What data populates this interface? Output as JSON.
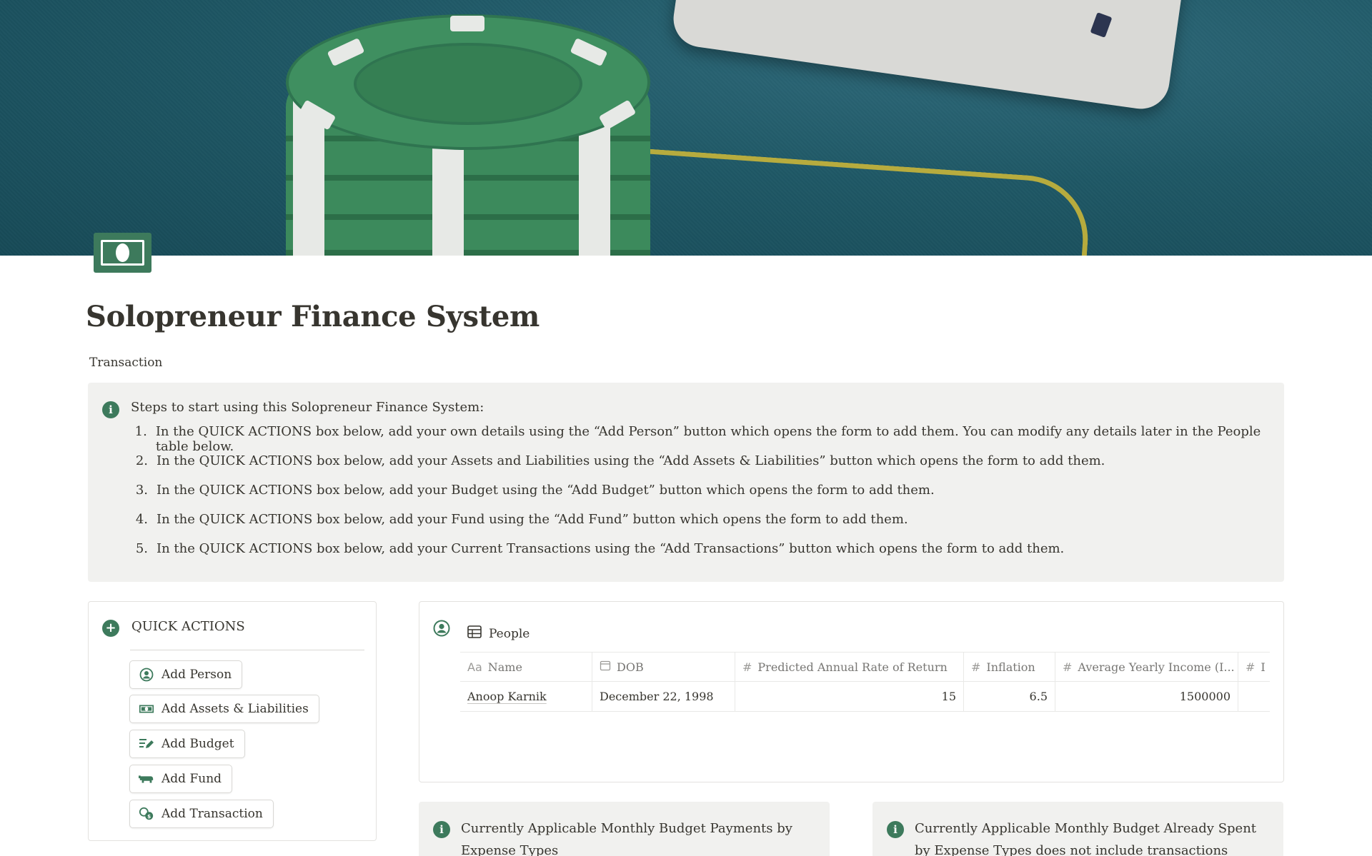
{
  "page": {
    "title": "Solopreneur Finance System",
    "subtitle": "Transaction",
    "icon": "dollar-bill-icon"
  },
  "callout": {
    "icon": "info-icon",
    "lead": "Steps to start using this Solopreneur Finance System:",
    "steps": [
      {
        "num": "1.",
        "text": "In the QUICK ACTIONS box below, add your own details using the “Add Person” button which opens the form to add them. You can modify any details later in the People table below."
      },
      {
        "num": "2.",
        "text": "In the QUICK ACTIONS box below, add your Assets and Liabilities using the “Add Assets & Liabilities” button which opens the form to add them."
      },
      {
        "num": "3.",
        "text": "In the QUICK ACTIONS box below, add your Budget using the “Add Budget” button which opens the form to add them."
      },
      {
        "num": "4.",
        "text": "In the QUICK ACTIONS box below, add your Fund using the “Add Fund” button which opens the form to add them."
      },
      {
        "num": "5.",
        "text": "In the QUICK ACTIONS box below, add your Current Transactions using the “Add Transactions” button which opens the form to add them."
      }
    ]
  },
  "quick_actions": {
    "title": "QUICK ACTIONS",
    "buttons": [
      {
        "label": "Add Person",
        "icon": "person-icon"
      },
      {
        "label": "Add Assets & Liabilities",
        "icon": "money-icon"
      },
      {
        "label": "Add Budget",
        "icon": "edit-list-icon"
      },
      {
        "label": "Add Fund",
        "icon": "pig-icon"
      },
      {
        "label": "Add Transaction",
        "icon": "exchange-icon"
      }
    ]
  },
  "people": {
    "title": "People",
    "columns": [
      {
        "label": "Name",
        "icon": "Aa"
      },
      {
        "label": "DOB",
        "icon": "calendar-icon"
      },
      {
        "label": "Predicted Annual Rate of Return",
        "icon": "#"
      },
      {
        "label": "Inflation",
        "icon": "#"
      },
      {
        "label": "Average Yearly Income (I...",
        "icon": "#"
      },
      {
        "label": "I",
        "icon": "#"
      }
    ],
    "rows": [
      {
        "name": "Anoop Karnik",
        "dob": "December 22, 1998",
        "rate": "15",
        "inflation": "6.5",
        "income": "1500000",
        "extra": ""
      }
    ]
  },
  "bottom_callouts": [
    {
      "text": "Currently Applicable Monthly Budget Payments by Expense Types"
    },
    {
      "text": "Currently Applicable Monthly Budget Already Spent by Expense Types does not include transactions which were"
    }
  ],
  "colors": {
    "accent_green": "#3d7a5c",
    "callout_bg": "#f1f1ef",
    "text": "#37352f"
  }
}
